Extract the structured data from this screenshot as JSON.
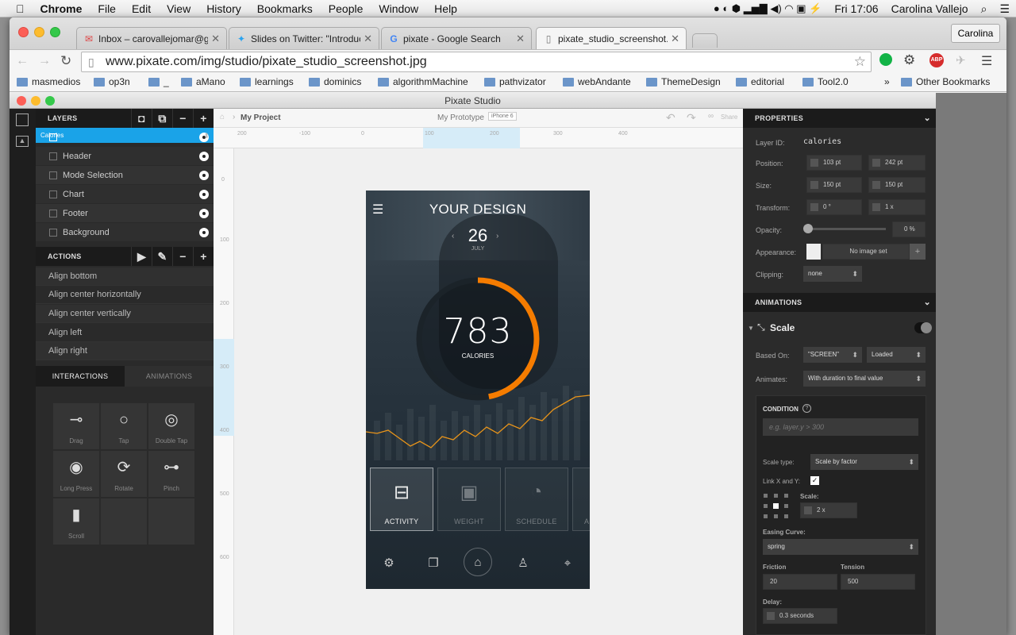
{
  "menubar": {
    "app": "Chrome",
    "items": [
      "File",
      "Edit",
      "View",
      "History",
      "Bookmarks",
      "People",
      "Window",
      "Help"
    ],
    "clock": "Fri 17:06",
    "user": "Carolina Vallejo"
  },
  "tabs": [
    {
      "label": "Inbox – carovallejomar@gm",
      "icon": "gmail-icon"
    },
    {
      "label": "Slides on Twitter: \"Introduc",
      "icon": "twitter-icon"
    },
    {
      "label": "pixate - Google Search",
      "icon": "google-icon"
    },
    {
      "label": "pixate_studio_screenshot.jp",
      "icon": "page-icon"
    }
  ],
  "profile_button": "Carolina",
  "url": "www.pixate.com/img/studio/pixate_studio_screenshot.jpg",
  "bookmarks": [
    "masmedios",
    "op3n",
    "_",
    "aMano",
    "learnings",
    "dominics",
    "algorithmMachine",
    "pathvizator",
    "webAndante",
    "ThemeDesign",
    "editorial",
    "Tool2.0"
  ],
  "other_bookmarks": "Other Bookmarks",
  "pixate": {
    "window_title": "Pixate Studio",
    "layers_title": "LAYERS",
    "layers": [
      "Calories",
      "Header",
      "Mode Selection",
      "Chart",
      "Footer",
      "Background"
    ],
    "actions_title": "ACTIONS",
    "actions": [
      "Align bottom",
      "Align center horizontally",
      "Align center vertically",
      "Align left",
      "Align right"
    ],
    "tabs": {
      "interactions": "INTERACTIONS",
      "animations": "ANIMATIONS"
    },
    "gestures": [
      "Drag",
      "Tap",
      "Double Tap",
      "Long Press",
      "Rotate",
      "Pinch",
      "Scroll"
    ],
    "breadcrumb": "My Project",
    "prototype": "My Prototype",
    "device": "iPhone 6",
    "share": "Share",
    "ruler_h": [
      "200",
      "-100",
      "0",
      "100",
      "200",
      "300",
      "400"
    ],
    "ruler_v": [
      "0",
      "100",
      "200",
      "300",
      "400",
      "500",
      "600"
    ]
  },
  "phone": {
    "title": "YOUR DESIGN",
    "day": "26",
    "month": "JULY",
    "value": "783",
    "unit": "CALORIES",
    "progress": 0.47,
    "tiles": [
      "ACTIVITY",
      "WEIGHT",
      "SCHEDULE",
      "A"
    ]
  },
  "properties": {
    "title": "PROPERTIES",
    "layer_id_label": "Layer ID:",
    "layer_id": "calories",
    "position_label": "Position:",
    "pos_x": "103 pt",
    "pos_y": "242 pt",
    "size_label": "Size:",
    "width": "150 pt",
    "height": "150 pt",
    "transform_label": "Transform:",
    "rotation": "0 °",
    "scale": "1 x",
    "opacity_label": "Opacity:",
    "opacity": "0 %",
    "appearance_label": "Appearance:",
    "image": "No image set",
    "clipping_label": "Clipping:",
    "clipping": "none"
  },
  "animations": {
    "title": "ANIMATIONS",
    "name": "Scale",
    "based_on_label": "Based On:",
    "based_on": "\"SCREEN\"",
    "event": "Loaded",
    "animates_label": "Animates:",
    "animates": "With duration to final value",
    "condition_label": "CONDITION",
    "condition_placeholder": "e.g. layer.y > 300",
    "scale_type_label": "Scale type:",
    "scale_type": "Scale by factor",
    "link_label": "Link X and Y:",
    "scale_label": "Scale:",
    "scale_value": "2 x",
    "easing_label": "Easing Curve:",
    "easing": "spring",
    "friction_label": "Friction",
    "friction": "20",
    "tension_label": "Tension",
    "tension": "500",
    "delay_label": "Delay:",
    "delay": "0.3 seconds"
  },
  "colors": {
    "accent": "#1aa3e8",
    "progress": "#f57c00"
  }
}
